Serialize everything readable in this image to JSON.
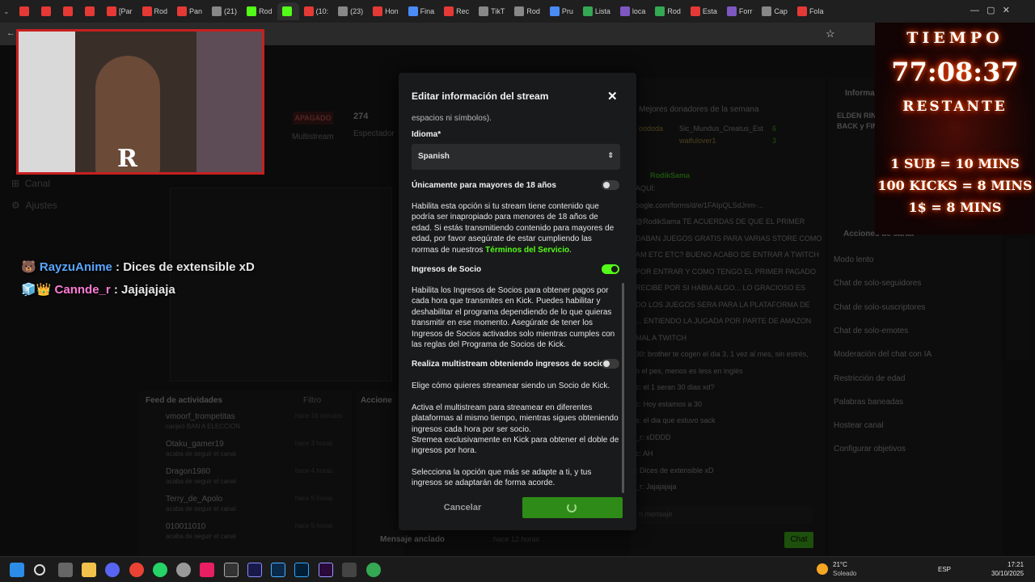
{
  "tabs": [
    "",
    "",
    "",
    "",
    "[Par",
    "Rod",
    "Pan",
    "(21)",
    "Rod",
    "",
    "(10:",
    "(23)",
    "Hon",
    "Fina",
    "Rec",
    "TikT",
    "Rod",
    "Pru",
    "Lista",
    "loca",
    "Rod",
    "Esta",
    "Forr",
    "Cap",
    "Fola"
  ],
  "modal": {
    "title": "Editar información del stream",
    "top_fragment": "espacios ni símbolos).",
    "language_label": "Idioma*",
    "language_value": "Spanish",
    "adult_label": "Únicamente para mayores de 18 años",
    "adult_desc": "Habilita esta opción si tu stream tiene contenido que podría ser inapropiado para menores de 18 años de edad. Si estás transmitiendo contenido para mayores de edad, por favor asegúrate de estar cumpliendo las normas de nuestros",
    "adult_link": "Términos del Servicio",
    "partner_label": "Ingresos de Socio",
    "partner_desc": "Habilita los Ingresos de Socios para obtener pagos por cada hora que transmites en Kick. Puedes habilitar y deshabilitar el programa dependiendo de lo que quieras transmitir en ese momento. Asegúrate de tener los Ingresos de Socios activados solo mientras cumples con las reglas del Programa de Socios de Kick.",
    "multistream_label": "Realiza multistream obteniendo ingresos de socio",
    "multistream_sub": "Elige cómo quieres streamear siendo un Socio de Kick.",
    "multistream_desc1": "Activa el multistream para streamear en diferentes plataformas al mismo tiempo, mientras sigues obteniendo ingresos cada hora por ser socio.",
    "multistream_desc2": "Stremea exclusivamente en Kick para obtener el doble de ingresos por hora.",
    "final_text": "Selecciona la opción que más se adapte a ti, y tus ingresos se adaptarán de forma acorde.",
    "cancel": "Cancelar"
  },
  "timer": {
    "line1": "TIEMPO",
    "time": "77:08:37",
    "line3": "RESTANTE",
    "r1": "1 SUB = 10 MINS",
    "r2": "100 KICKS = 8 MINS",
    "r3": "1$ = 8 MINS"
  },
  "overlay_chat": [
    {
      "user": "RayzuAnime",
      "msg": " : Dices de extensible xD"
    },
    {
      "user": "Cannde_r",
      "msg": " : Jajajajaja"
    }
  ],
  "bg": {
    "apagado": "APAGADO",
    "viewers": "274",
    "espectadores": "Espectador",
    "multistream": "Multistream",
    "canal": "Canal",
    "ajustes": "Ajustes",
    "feed_title": "Feed de actividades",
    "filtro": "Filtro",
    "acciones": "Accione",
    "feed": [
      {
        "name": "vmoorf_trompetitas",
        "sub": "canjeó BAN A ELECCION",
        "time": "hace 16 minutos"
      },
      {
        "name": "Otaku_gamer19",
        "sub": "acaba de seguir el canal",
        "time": "hace 3 horas"
      },
      {
        "name": "Dragon1980",
        "sub": "acaba de seguir el canal",
        "time": "hace 4 horas"
      },
      {
        "name": "Terry_de_Apolo",
        "sub": "acaba de seguir el canal",
        "time": "hace 5 horas"
      },
      {
        "name": "010011010",
        "sub": "acaba de seguir el canal",
        "time": "hace 5 horas"
      }
    ],
    "pinned": "Mensaje anclado",
    "pinned_time": "hace 12 horas",
    "donors_title": "Mejores donadores de la semana",
    "donor1": "Sic_Mundus_Creatus_Est",
    "donor1_n": "6",
    "donor2": "waifulover1",
    "donor2_n": "3",
    "donor0": "oododa",
    "pin_user": "RodikSama",
    "chat_snippets": [
      "AQUÍ:",
      "oogle.com/forms/d/e/1FAIpQLSdJnm-...",
      "@RodikSama TE ACUERDAS DE QUE EL PRIMER",
      "DABAN JUEGOS GRATIS PARA VARIAS STORE COMO",
      "AM ETC ETC? BUENO ACABO DE ENTRAR A TWITCH",
      "POR ENTRAR Y COMO TENGO EL PRIMER PAGADO",
      "RECIBE POR SI HABIA ALGO... LO GRACIOSO ES",
      "DO LOS JUEGOS SERA PARA LA PLATAFORMA DE",
      "... ENTIENDO LA JUGADA POR PARTE DE AMAZON",
      "MAL A TWITCH",
      "30: brother te cogen el dia 3, 1 vez al mes, sin estrés,",
      "n el pes, menos es less en inglés",
      "c: el 1 seran 30 dias xd?",
      "c: Hoy estamos a 30",
      "s: el dia que estuvo sack",
      "_r: xDDDD",
      "c: AH",
      ": Dices de extensible xD",
      "_r: Jajajajaja"
    ],
    "chat_placeholder": "n mensaje",
    "chat_btn": "Chat",
    "info_title": "Informa",
    "game_title": "ELDEN RING en P",
    "game_sub": "BACK y FINAL de GUS... M ORIGIN",
    "acciones_title": "Acciones de canal",
    "actions": [
      "Modo lento",
      "Chat de solo-seguidores",
      "Chat de solo-suscriptores",
      "Chat de solo-emotes",
      "Moderación del chat con IA",
      "Restricción de edad",
      "Palabras baneadas",
      "Hostear canal",
      "Configurar objetivos"
    ]
  },
  "taskbar": {
    "temp": "21°C",
    "weather": "Soleado",
    "lang": "ESP",
    "time": "17:21",
    "date": "30/10/2025"
  }
}
